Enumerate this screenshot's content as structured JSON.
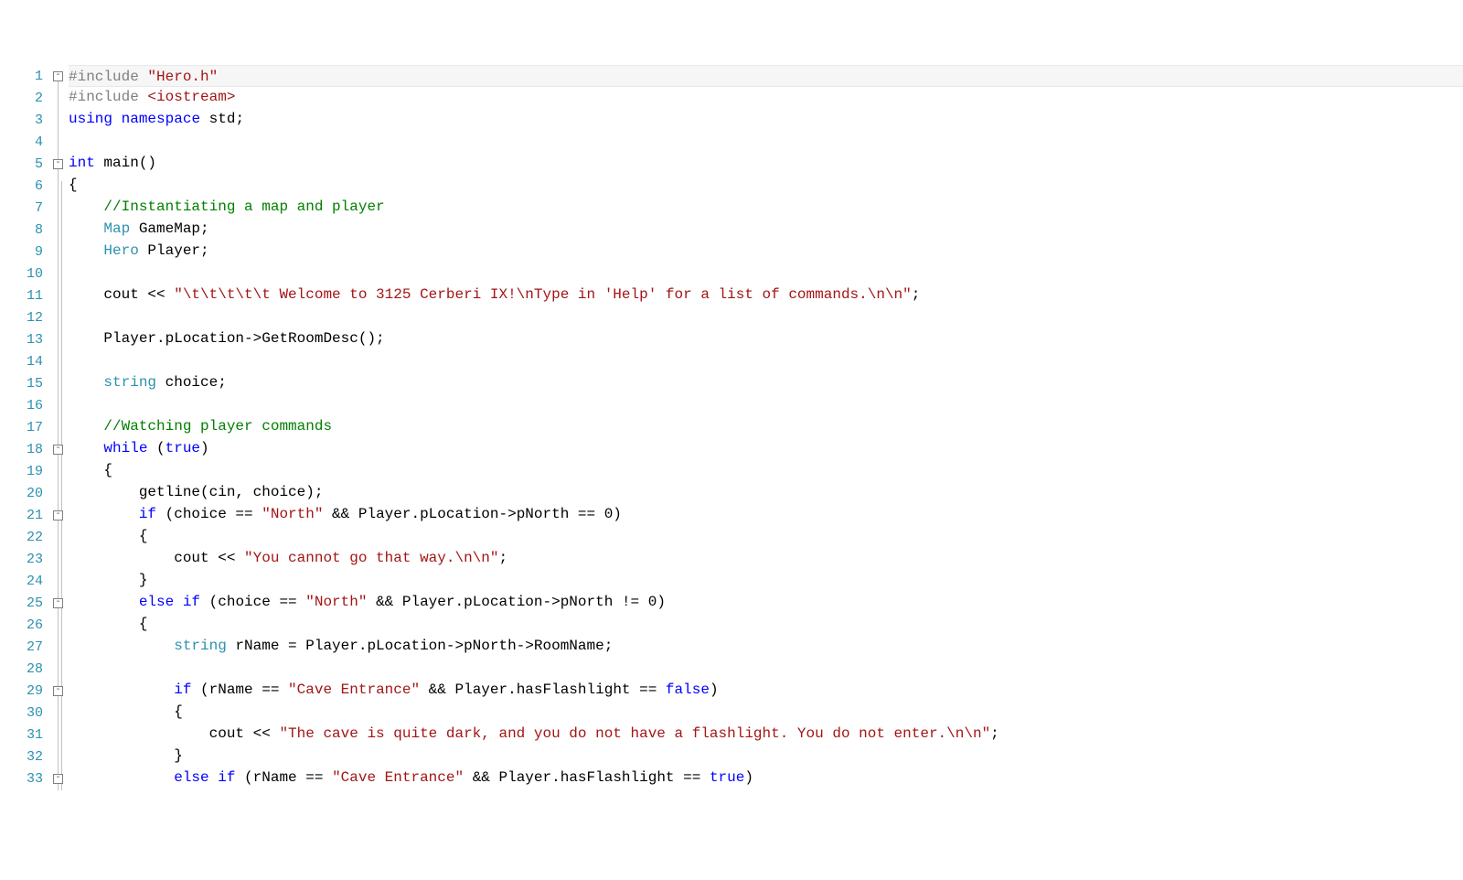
{
  "editor": {
    "lineCount": 33,
    "foldBoxes": [
      1,
      5,
      18,
      21,
      25,
      29,
      33
    ],
    "highlightLine": 1,
    "lines": {
      "1": [
        {
          "t": "#include ",
          "c": "tok-pp"
        },
        {
          "t": "\"Hero.h\"",
          "c": "tok-str"
        }
      ],
      "2": [
        {
          "t": "#include ",
          "c": "tok-pp"
        },
        {
          "t": "<iostream>",
          "c": "tok-str"
        }
      ],
      "3": [
        {
          "t": "using",
          "c": "tok-kw"
        },
        {
          "t": " ",
          "c": ""
        },
        {
          "t": "namespace",
          "c": "tok-kw"
        },
        {
          "t": " std;",
          "c": "tok-id"
        }
      ],
      "4": [],
      "5": [
        {
          "t": "int",
          "c": "tok-kw"
        },
        {
          "t": " main()",
          "c": "tok-id"
        }
      ],
      "6": [
        {
          "t": "{",
          "c": "tok-id"
        }
      ],
      "7": [
        {
          "t": "    ",
          "c": ""
        },
        {
          "t": "//Instantiating a map and player",
          "c": "tok-cmt"
        }
      ],
      "8": [
        {
          "t": "    ",
          "c": ""
        },
        {
          "t": "Map",
          "c": "tok-type"
        },
        {
          "t": " GameMap;",
          "c": "tok-id"
        }
      ],
      "9": [
        {
          "t": "    ",
          "c": ""
        },
        {
          "t": "Hero",
          "c": "tok-type"
        },
        {
          "t": " Player;",
          "c": "tok-id"
        }
      ],
      "10": [],
      "11": [
        {
          "t": "    cout << ",
          "c": "tok-id"
        },
        {
          "t": "\"\\t\\t\\t\\t\\t Welcome to 3125 Cerberi IX!\\nType in 'Help' for a list of commands.\\n\\n\"",
          "c": "tok-str"
        },
        {
          "t": ";",
          "c": "tok-id"
        }
      ],
      "12": [],
      "13": [
        {
          "t": "    Player.pLocation->GetRoomDesc();",
          "c": "tok-id"
        }
      ],
      "14": [],
      "15": [
        {
          "t": "    ",
          "c": ""
        },
        {
          "t": "string",
          "c": "tok-type"
        },
        {
          "t": " choice;",
          "c": "tok-id"
        }
      ],
      "16": [],
      "17": [
        {
          "t": "    ",
          "c": ""
        },
        {
          "t": "//Watching player commands",
          "c": "tok-cmt"
        }
      ],
      "18": [
        {
          "t": "    ",
          "c": ""
        },
        {
          "t": "while",
          "c": "tok-kw"
        },
        {
          "t": " (",
          "c": "tok-id"
        },
        {
          "t": "true",
          "c": "tok-bool"
        },
        {
          "t": ")",
          "c": "tok-id"
        }
      ],
      "19": [
        {
          "t": "    {",
          "c": "tok-id"
        }
      ],
      "20": [
        {
          "t": "        getline(cin, choice);",
          "c": "tok-id"
        }
      ],
      "21": [
        {
          "t": "        ",
          "c": ""
        },
        {
          "t": "if",
          "c": "tok-kw"
        },
        {
          "t": " (choice == ",
          "c": "tok-id"
        },
        {
          "t": "\"North\"",
          "c": "tok-str"
        },
        {
          "t": " && Player.pLocation->pNorth == 0)",
          "c": "tok-id"
        }
      ],
      "22": [
        {
          "t": "        {",
          "c": "tok-id"
        }
      ],
      "23": [
        {
          "t": "            cout << ",
          "c": "tok-id"
        },
        {
          "t": "\"You cannot go that way.\\n\\n\"",
          "c": "tok-str"
        },
        {
          "t": ";",
          "c": "tok-id"
        }
      ],
      "24": [
        {
          "t": "        }",
          "c": "tok-id"
        }
      ],
      "25": [
        {
          "t": "        ",
          "c": ""
        },
        {
          "t": "else",
          "c": "tok-kw"
        },
        {
          "t": " ",
          "c": ""
        },
        {
          "t": "if",
          "c": "tok-kw"
        },
        {
          "t": " (choice == ",
          "c": "tok-id"
        },
        {
          "t": "\"North\"",
          "c": "tok-str"
        },
        {
          "t": " && Player.pLocation->pNorth != 0)",
          "c": "tok-id"
        }
      ],
      "26": [
        {
          "t": "        {",
          "c": "tok-id"
        }
      ],
      "27": [
        {
          "t": "            ",
          "c": ""
        },
        {
          "t": "string",
          "c": "tok-type"
        },
        {
          "t": " rName = Player.pLocation->pNorth->RoomName;",
          "c": "tok-id"
        }
      ],
      "28": [],
      "29": [
        {
          "t": "            ",
          "c": ""
        },
        {
          "t": "if",
          "c": "tok-kw"
        },
        {
          "t": " (rName == ",
          "c": "tok-id"
        },
        {
          "t": "\"Cave Entrance\"",
          "c": "tok-str"
        },
        {
          "t": " && Player.hasFlashlight == ",
          "c": "tok-id"
        },
        {
          "t": "false",
          "c": "tok-bool"
        },
        {
          "t": ")",
          "c": "tok-id"
        }
      ],
      "30": [
        {
          "t": "            {",
          "c": "tok-id"
        }
      ],
      "31": [
        {
          "t": "                cout << ",
          "c": "tok-id"
        },
        {
          "t": "\"The cave is quite dark, and you do not have a flashlight. You do not enter.\\n\\n\"",
          "c": "tok-str"
        },
        {
          "t": ";",
          "c": "tok-id"
        }
      ],
      "32": [
        {
          "t": "            }",
          "c": "tok-id"
        }
      ],
      "33": [
        {
          "t": "            ",
          "c": ""
        },
        {
          "t": "else",
          "c": "tok-kw"
        },
        {
          "t": " ",
          "c": ""
        },
        {
          "t": "if",
          "c": "tok-kw"
        },
        {
          "t": " (rName == ",
          "c": "tok-id"
        },
        {
          "t": "\"Cave Entrance\"",
          "c": "tok-str"
        },
        {
          "t": " && Player.hasFlashlight == ",
          "c": "tok-id"
        },
        {
          "t": "true",
          "c": "tok-bool"
        },
        {
          "t": ")",
          "c": "tok-id"
        }
      ]
    }
  }
}
